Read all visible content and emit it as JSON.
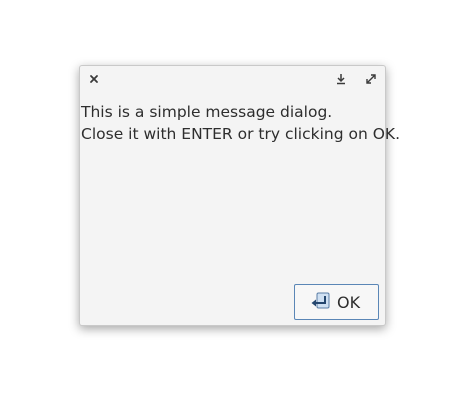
{
  "dialog": {
    "titlebar": {
      "close_icon": "close-icon",
      "minimize_icon": "minimize-icon",
      "maximize_icon": "maximize-icon"
    },
    "message_lines": [
      "This is a simple message dialog.",
      "Close it with ENTER or try clicking on OK."
    ],
    "ok_button": {
      "label": "OK",
      "icon": "enter-key-icon"
    }
  },
  "colors": {
    "background": "#f4f4f4",
    "text": "#2e2e2e",
    "button_border": "#5a86b6"
  }
}
